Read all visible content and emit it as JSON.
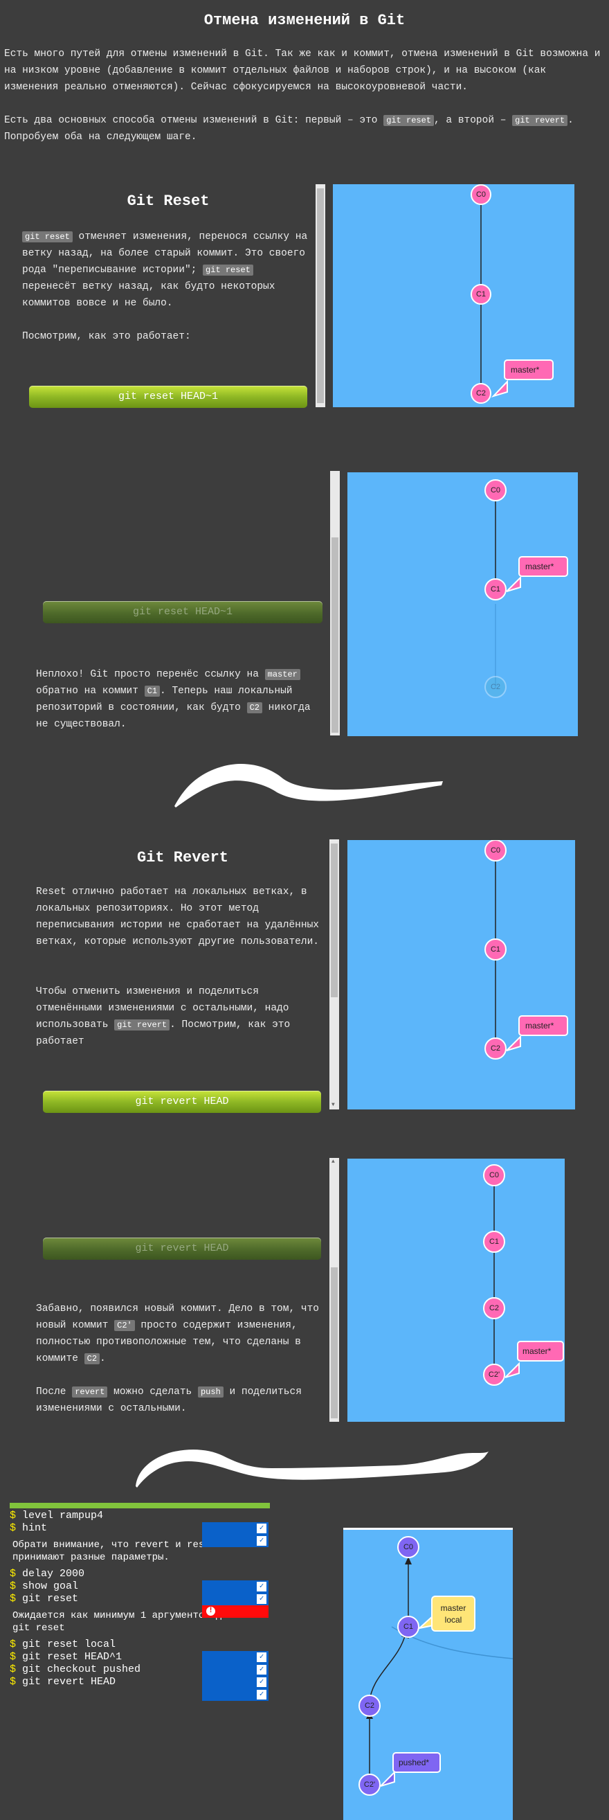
{
  "page": {
    "title": "Отмена изменений в Git",
    "intro1": "Есть много путей для отмены изменений в Git. Так же как и коммит, отмена изменений в Git возможна и на низком уровне (добавление в коммит отдельных файлов и наборов строк), и на высоком (как изменения реально отменяются). Сейчас сфокусируемся на высокоуровневой части.",
    "intro2_a": "Есть два основных способа отмены изменений в Git: первый – это ",
    "intro2_code1": "git reset",
    "intro2_b": ", а второй – ",
    "intro2_code2": "git revert",
    "intro2_c": ". Попробуем оба на следующем шаге."
  },
  "reset1": {
    "title": "Git Reset",
    "code1": "git reset",
    "text1": " отменяет изменения, перенося ссылку на ветку назад, на более старый коммит. Это своего рода \"переписывание истории\"; ",
    "code2": "git reset",
    "text2": " перенесёт ветку назад, как будто некоторых коммитов вовсе и не было.",
    "text3": "Посмотрим, как это работает:",
    "button": "git reset HEAD~1",
    "nodes": [
      "C0",
      "C1",
      "C2"
    ],
    "branch": "master*"
  },
  "reset2": {
    "button": "git reset HEAD~1",
    "t1": "Неплохо! Git просто перенёс ссылку на ",
    "c1": "master",
    "t2": " обратно на коммит ",
    "c2": "C1",
    "t3": ". Теперь наш локальный репозиторий в состоянии, как будто ",
    "c3": "C2",
    "t4": " никогда не существовал.",
    "nodes": [
      "C0",
      "C1",
      "C2"
    ],
    "branch": "master*"
  },
  "revert1": {
    "title": "Git Revert",
    "text1": "Reset отлично работает на локальных ветках, в локальных репозиториях. Но этот метод переписывания истории не сработает на удалённых ветках, которые используют другие пользователи.",
    "text2a": "Чтобы отменить изменения и поделиться отменёнными изменениями с остальными, надо использовать ",
    "code": "git revert",
    "text2b": ". Посмотрим, как это работает",
    "button": "git revert HEAD",
    "nodes": [
      "C0",
      "C1",
      "C2"
    ],
    "branch": "master*"
  },
  "revert2": {
    "button": "git revert HEAD",
    "t1": "Забавно, появился новый коммит. Дело в том, что новый коммит ",
    "c1": "C2'",
    "t2": " просто содержит изменения, полностью противоположные тем, что сделаны в коммите ",
    "c2": "C2",
    "t3": ".",
    "t4": "После ",
    "c3": "revert",
    "t5": " можно сделать ",
    "c4": "push",
    "t6": " и поделиться изменениями с остальными.",
    "nodes": [
      "C0",
      "C1",
      "C2",
      "C2'"
    ],
    "branch": "master*"
  },
  "terminal": {
    "prompt": "$",
    "lines1": [
      "level rampup4",
      "hint"
    ],
    "msg1": "Обрати внимание, что revert и reset принимают разные параметры.",
    "lines2": [
      "delay 2000",
      "show goal",
      "git reset"
    ],
    "msg2": "Ожидается как минимум 1 аргументов для with git reset",
    "lines3": [
      "git reset local",
      "git reset HEAD^1",
      "git checkout pushed",
      "git revert HEAD"
    ],
    "check": "✓",
    "error": "!"
  },
  "goal": {
    "nodes": [
      "C0",
      "C1",
      "C2",
      "C2'"
    ],
    "label_local": [
      "master",
      "local"
    ],
    "label_pushed": "pushed*"
  },
  "colors": {
    "viz_bg": "#5cb6fa",
    "node_pink": "#ff69b4",
    "node_purple": "#7f66f2",
    "label_yellow": "#ffe577",
    "ok_blue": "#0a61c9",
    "error_red": "#ff0b0b"
  }
}
